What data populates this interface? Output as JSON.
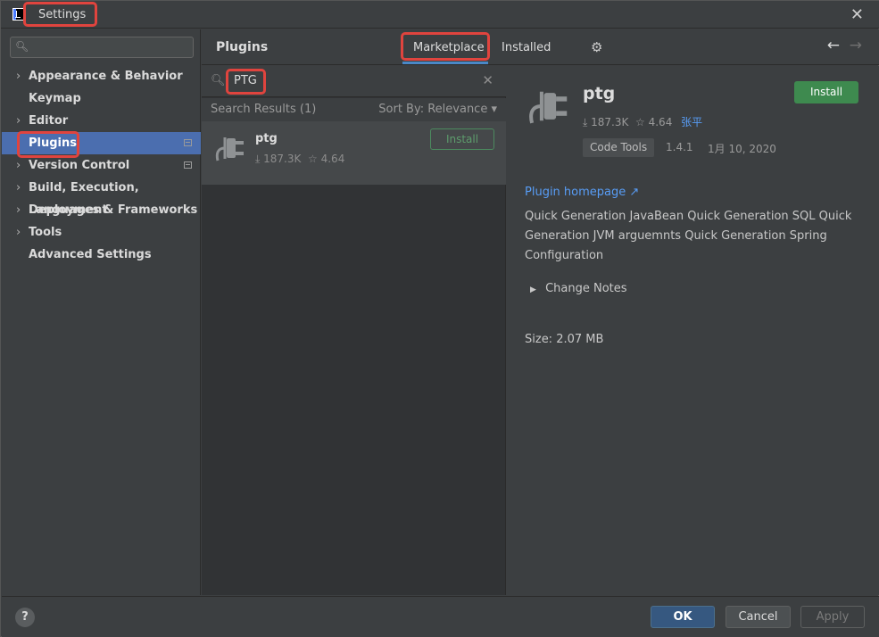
{
  "window": {
    "title": "Settings"
  },
  "sidebar": {
    "search_placeholder": "",
    "items": [
      {
        "label": "Appearance & Behavior",
        "expandable": true
      },
      {
        "label": "Keymap",
        "expandable": false
      },
      {
        "label": "Editor",
        "expandable": true
      },
      {
        "label": "Plugins",
        "expandable": false,
        "selected": true
      },
      {
        "label": "Version Control",
        "expandable": true
      },
      {
        "label": "Build, Execution, Deployment",
        "expandable": true
      },
      {
        "label": "Languages & Frameworks",
        "expandable": true
      },
      {
        "label": "Tools",
        "expandable": true
      },
      {
        "label": "Advanced Settings",
        "expandable": false
      }
    ]
  },
  "header": {
    "title": "Plugins",
    "tabs": [
      {
        "label": "Marketplace",
        "active": true
      },
      {
        "label": "Installed",
        "active": false
      }
    ]
  },
  "list": {
    "search_query": "PTG",
    "results_label": "Search Results (1)",
    "sort_label": "Sort By: Relevance",
    "plugins": [
      {
        "name": "ptg",
        "downloads": "187.3K",
        "rating": "4.64",
        "install_label": "Install"
      }
    ]
  },
  "detail": {
    "name": "ptg",
    "install_label": "Install",
    "downloads": "187.3K",
    "rating": "4.64",
    "vendor": "张平",
    "tag": "Code Tools",
    "version": "1.4.1",
    "date": "1月 10, 2020",
    "homepage_label": "Plugin homepage",
    "homepage_arrow": "↗",
    "description": "Quick Generation JavaBean Quick Generation SQL Quick Generation JVM arguemnts Quick Generation Spring Configuration",
    "change_notes_label": "Change Notes",
    "size_label": "Size: 2.07 MB"
  },
  "footer": {
    "help_label": "?",
    "ok_label": "OK",
    "cancel_label": "Cancel",
    "apply_label": "Apply"
  },
  "colors": {
    "accent": "#4b6eaf",
    "install_green": "#3e8a4f",
    "link": "#589df6",
    "highlight": "#e0443e"
  }
}
